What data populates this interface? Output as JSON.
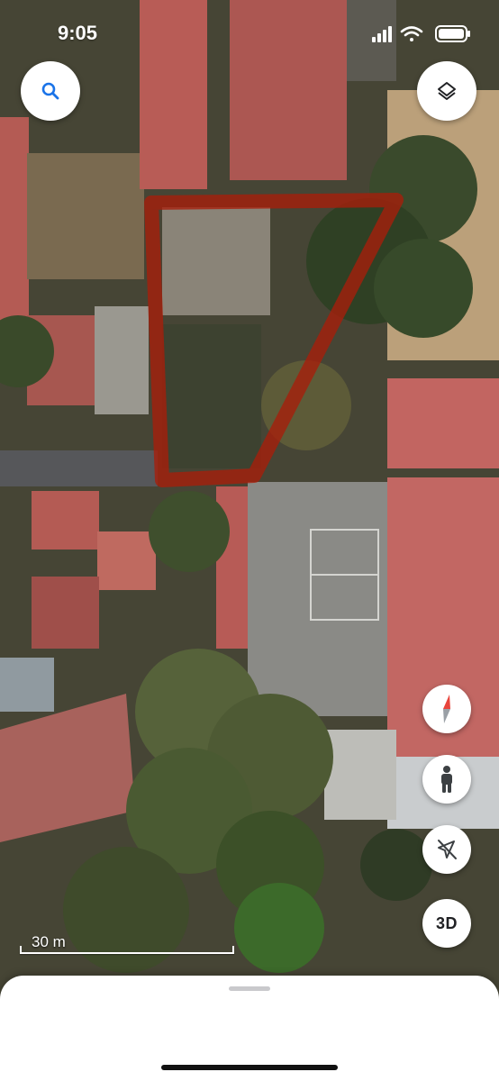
{
  "status_bar": {
    "time": "9:05",
    "icons": [
      "cellular-signal-icon",
      "wifi-icon",
      "battery-icon"
    ]
  },
  "map": {
    "type": "satellite",
    "annotation_color": "#a81e0a",
    "scale_label": "30 m"
  },
  "controls": {
    "search": {
      "icon": "search-icon",
      "color": "#1a73e8"
    },
    "layers": {
      "icon": "layers-icon"
    },
    "compass": {
      "icon": "compass-icon"
    },
    "street_view": {
      "icon": "pegman-icon"
    },
    "location": {
      "icon": "location-off-icon"
    },
    "three_d": {
      "label": "3D"
    }
  },
  "bottom_sheet": {
    "handle": "drag-handle"
  }
}
